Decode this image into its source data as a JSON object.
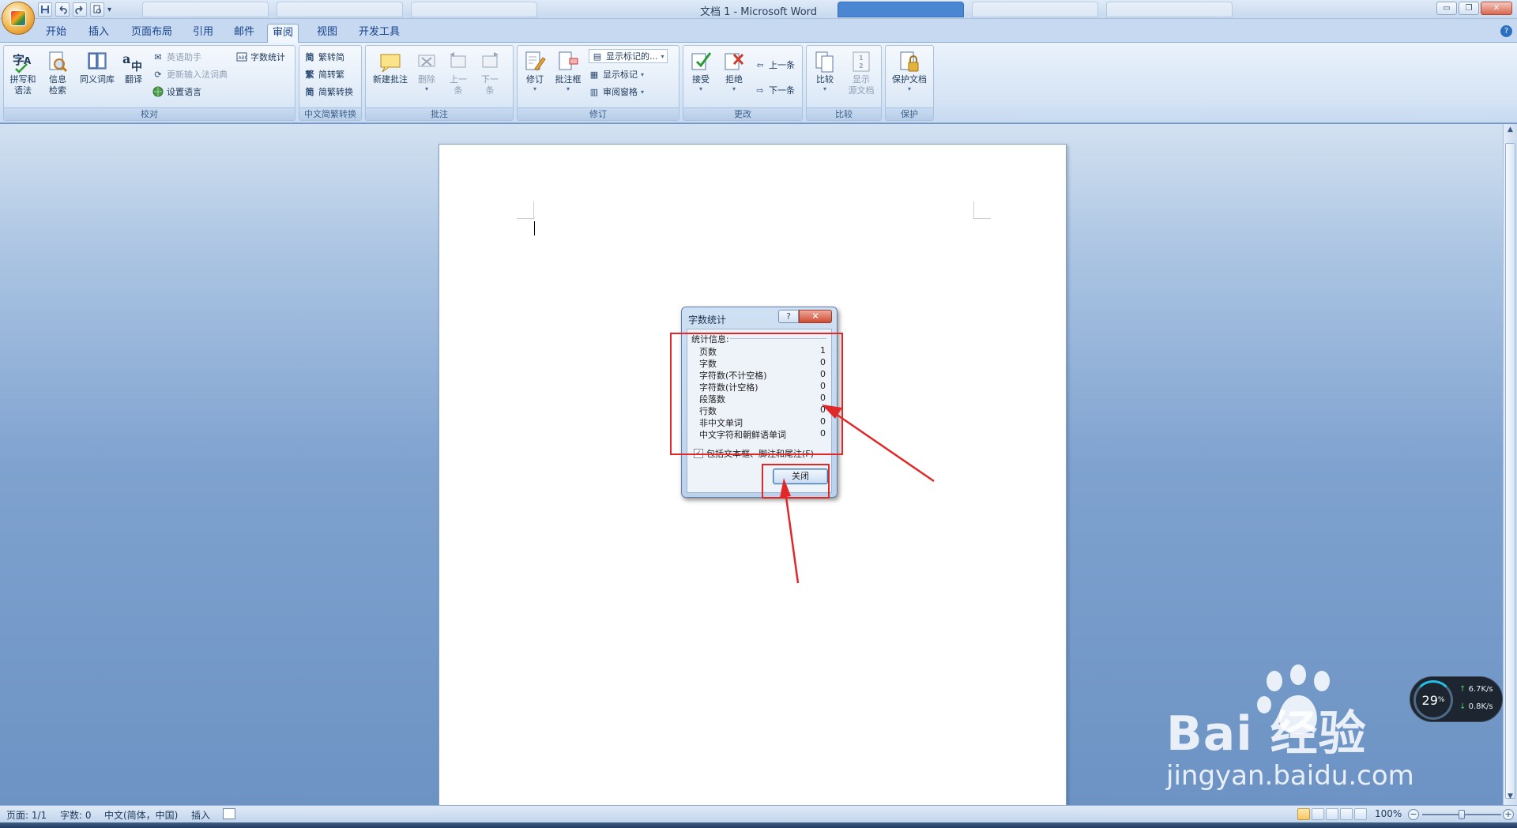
{
  "window": {
    "doc_title": "文档 1 - Microsoft Word",
    "minimize_glyph": "▭",
    "restore_glyph": "❐",
    "close_glyph": "✕"
  },
  "qat": {
    "save_icon": "save-icon",
    "undo_icon": "undo-icon",
    "redo_icon": "redo-icon",
    "preview_icon": "print-preview-icon",
    "customize_glyph": "▾"
  },
  "ribbon_tabs": [
    "开始",
    "插入",
    "页面布局",
    "引用",
    "邮件",
    "审阅",
    "视图",
    "开发工具"
  ],
  "active_tab": "审阅",
  "ribbon": {
    "proofing": {
      "label": "校对",
      "spelling": "拼写和\n语法",
      "research": "信息\n检索",
      "thesaurus": "同义词库",
      "translate": "翻译",
      "english_assistant": "英语助手",
      "update_ime": "更新输入法词典",
      "set_language": "设置语言",
      "word_count": "字数统计"
    },
    "chinese_conversion": {
      "label": "中文简繁转换",
      "to_simplified": "繁转简",
      "to_traditional": "简转繁",
      "conversion": "简繁转换"
    },
    "comments": {
      "label": "批注",
      "new_comment": "新建批注",
      "delete": "删除",
      "previous": "上一\n条",
      "next": "下一\n条"
    },
    "tracking": {
      "label": "修订",
      "track_changes": "修订",
      "balloons": "批注框",
      "final_showing": "显示标记的...",
      "show_markup": "显示标记",
      "reviewing_pane": "审阅窗格"
    },
    "changes": {
      "label": "更改",
      "accept": "接受",
      "reject": "拒绝",
      "previous": "上一条",
      "next": "下一条"
    },
    "compare": {
      "label": "比较",
      "compare": "比较",
      "show_source": "显示\n源文档"
    },
    "protect": {
      "label": "保护",
      "protect_document": "保护文档"
    }
  },
  "dialog": {
    "title": "字数统计",
    "help": "?",
    "close_glyph": "✕",
    "stats_heading": "统计信息:",
    "stats": [
      {
        "label": "页数",
        "value": "1"
      },
      {
        "label": "字数",
        "value": "0"
      },
      {
        "label": "字符数(不计空格)",
        "value": "0"
      },
      {
        "label": "字符数(计空格)",
        "value": "0"
      },
      {
        "label": "段落数",
        "value": "0"
      },
      {
        "label": "行数",
        "value": "0"
      },
      {
        "label": "非中文单词",
        "value": "0"
      },
      {
        "label": "中文字符和朝鲜语单词",
        "value": "0"
      }
    ],
    "include_label": "包括文本框、脚注和尾注(F)",
    "include_checked": true,
    "close_button": "关闭"
  },
  "status": {
    "page": "页面: 1/1",
    "words": "字数: 0",
    "language": "中文(简体，中国)",
    "mode": "插入",
    "zoom": "100%",
    "zoom_minus": "−",
    "zoom_plus": "+"
  },
  "net_widget": {
    "percent": "29",
    "percent_unit": "%",
    "upload": "6.7K/s",
    "download": "0.8K/s",
    "upload_glyph": "↑",
    "download_glyph": "↓"
  },
  "watermark": {
    "brand": "Bai  经验",
    "site": "jingyan.baidu.com"
  },
  "colors": {
    "annotation_red": "#e02828",
    "ribbon_text": "#15428b",
    "doc_bg": "#6f95c4"
  }
}
